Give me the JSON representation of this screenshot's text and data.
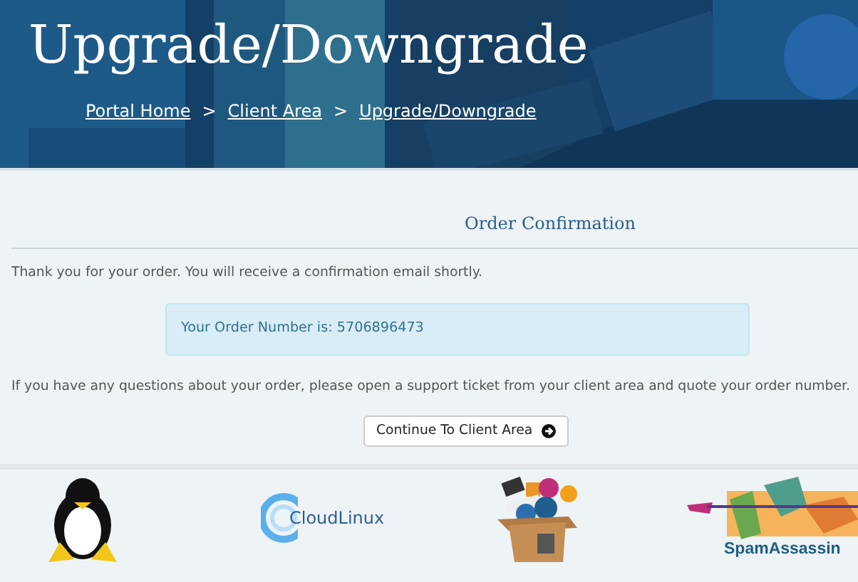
{
  "header": {
    "title": "Upgrade/Downgrade",
    "breadcrumb": [
      {
        "label": "Portal Home"
      },
      {
        "label": "Client Area"
      },
      {
        "label": "Upgrade/Downgrade"
      }
    ],
    "separator": ">"
  },
  "order": {
    "heading": "Order Confirmation",
    "thanks": "Thank you for your order. You will receive a confirmation email shortly.",
    "number_text": "Your Order Number is: 5706896473",
    "questions": "If you have any questions about your order, please open a support ticket from your client area and quote your order number.",
    "button": "Continue To Client Area"
  },
  "logos": [
    {
      "kind": "penguin"
    },
    {
      "kind": "cloud",
      "text": "CloudLinux"
    },
    {
      "kind": "box"
    },
    {
      "kind": "spam",
      "text": "SpamAssassin"
    }
  ]
}
